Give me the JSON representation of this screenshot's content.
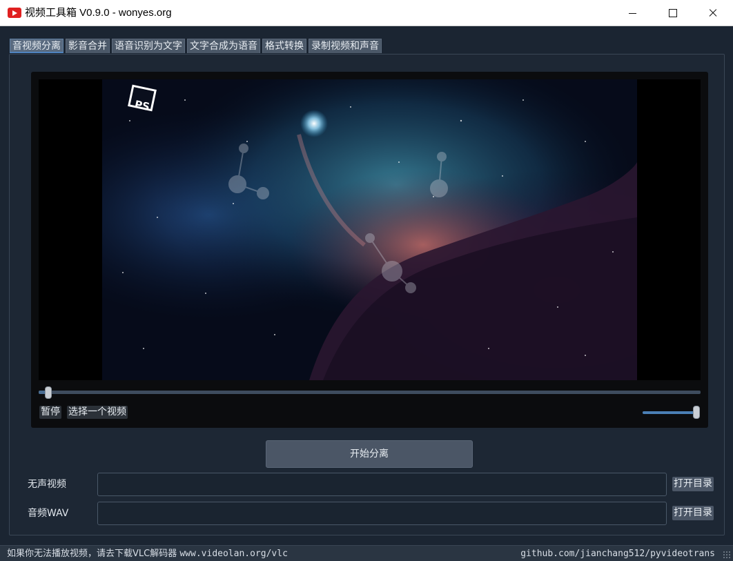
{
  "window": {
    "title": "视频工具箱 V0.9.0 - wonyes.org"
  },
  "tabs": [
    {
      "label": "音视频分离",
      "active": true
    },
    {
      "label": "影音合并",
      "active": false
    },
    {
      "label": "语音识别为文字",
      "active": false
    },
    {
      "label": "文字合成为语音",
      "active": false
    },
    {
      "label": "格式转换",
      "active": false
    },
    {
      "label": "录制视频和声音",
      "active": false
    }
  ],
  "player": {
    "pause_label": "暂停",
    "choose_label": "选择一个视频",
    "progress_fraction": 0.01,
    "volume_fraction": 1.0,
    "logo_text": "PS"
  },
  "actions": {
    "start_label": "开始分离"
  },
  "outputs": {
    "silent_video": {
      "label": "无声视频",
      "value": "",
      "button": "打开目录"
    },
    "audio_wav": {
      "label": "音频WAV",
      "value": "",
      "button": "打开目录"
    }
  },
  "status": {
    "left_text": "如果你无法播放视频，请去下载VLC解码器",
    "left_link": "www.videolan.org/vlc",
    "right_text": "github.com/jianchang512/pyvideotrans"
  },
  "colors": {
    "accent": "#4a7fb5",
    "background": "#1b2532",
    "app_icon": "#e02020"
  }
}
